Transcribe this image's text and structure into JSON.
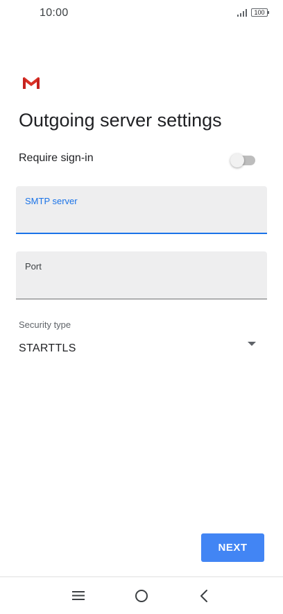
{
  "status_bar": {
    "time": "10:00",
    "battery": "100",
    "icons": [
      "signal-icon",
      "battery-icon"
    ]
  },
  "app": {
    "logo_icon": "gmail-logo-icon",
    "brand_color": "#d93025"
  },
  "page": {
    "title": "Outgoing server settings"
  },
  "require_signin": {
    "label": "Require sign-in",
    "enabled": false
  },
  "smtp_server": {
    "label": "SMTP server",
    "value": "",
    "focused": true
  },
  "port": {
    "label": "Port",
    "value": ""
  },
  "security": {
    "label": "Security type",
    "value": "STARTTLS"
  },
  "actions": {
    "next_label": "NEXT"
  },
  "nav_bar": {
    "icons": [
      "menu-icon",
      "home-icon",
      "back-icon"
    ]
  },
  "colors": {
    "accent": "#1a73e8",
    "button": "#4285f4",
    "field_bg": "#eeeeef"
  }
}
